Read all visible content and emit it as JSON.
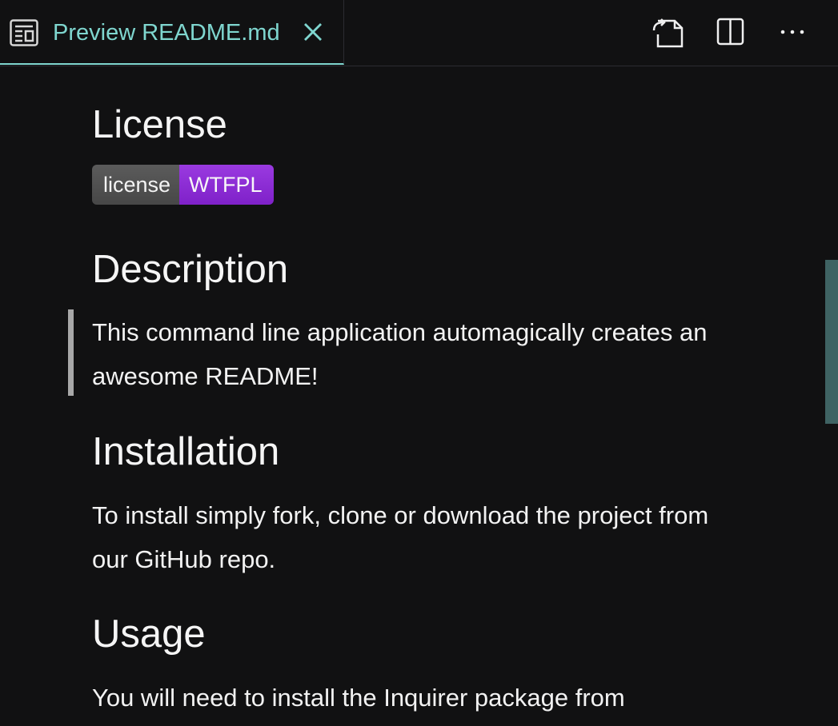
{
  "tab": {
    "title": "Preview README.md",
    "icon": "preview-icon",
    "close_icon": "close-icon"
  },
  "toolbar": {
    "open_source_icon": "open-source-icon",
    "split_icon": "split-editor-icon",
    "more_icon": "more-actions-icon"
  },
  "colors": {
    "background": "#111112",
    "tab_accent": "#7fd6cf",
    "badge_left": "#555555",
    "badge_right": "#8a2be2",
    "scrollbar": "#3f6363"
  },
  "markdown": {
    "license": {
      "heading": "License",
      "badge_label": "license",
      "badge_value": "WTFPL"
    },
    "description": {
      "heading": "Description",
      "quote": "This command line application automagically creates an awesome README!"
    },
    "installation": {
      "heading": "Installation",
      "text": "To install simply fork, clone or download the project from our GitHub repo."
    },
    "usage": {
      "heading": "Usage",
      "text": "You will need to install the Inquirer package from"
    }
  }
}
